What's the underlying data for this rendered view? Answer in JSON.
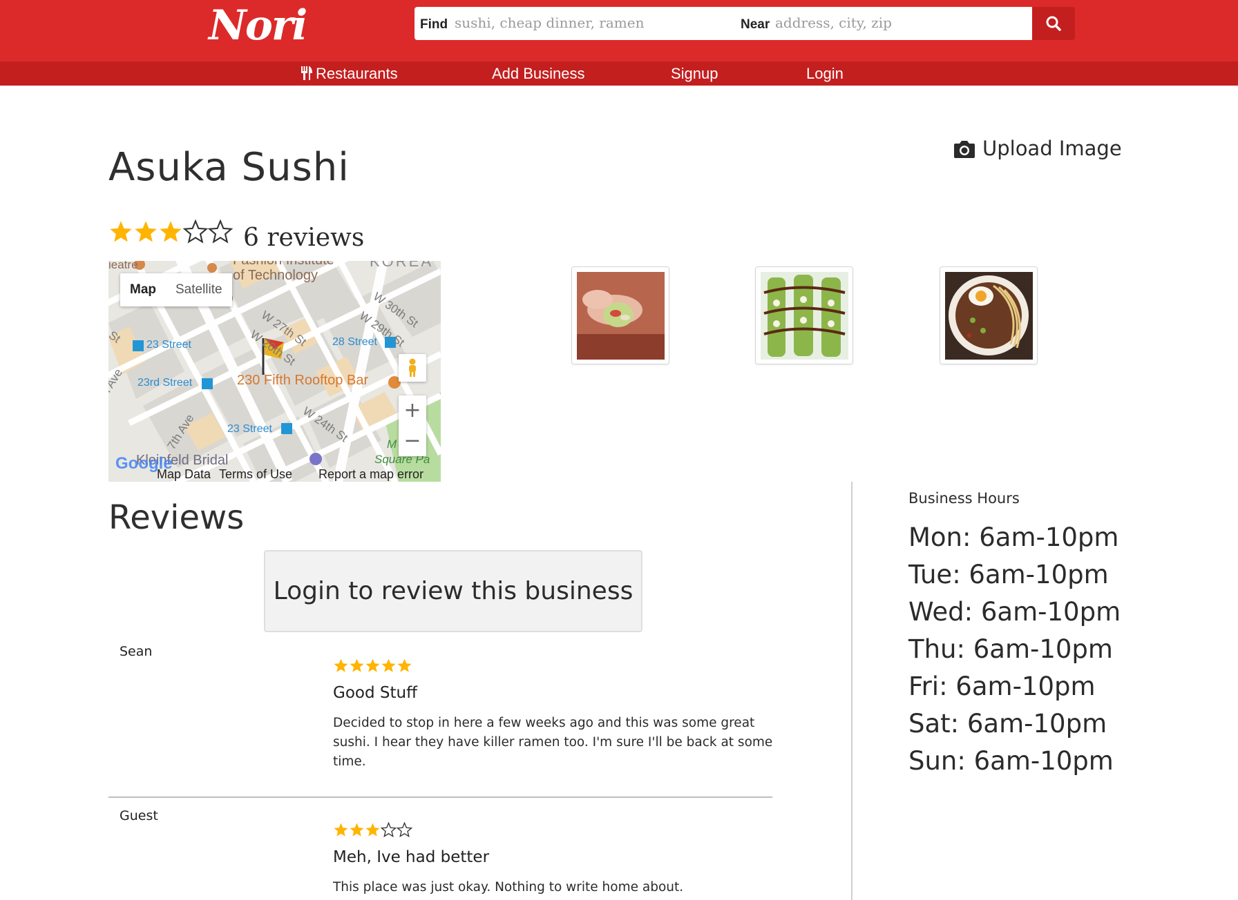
{
  "header": {
    "logo": "Nori",
    "find_label": "Find",
    "find_placeholder": "sushi, cheap dinner, ramen",
    "near_label": "Near",
    "near_placeholder": "address, city, zip",
    "search_icon": "search-icon"
  },
  "nav": {
    "items": [
      {
        "label": "Restaurants",
        "icon": "utensils-icon"
      },
      {
        "label": "Add Business"
      },
      {
        "label": "Signup"
      },
      {
        "label": "Login"
      }
    ]
  },
  "business": {
    "name": "Asuka Sushi",
    "upload_label": "Upload Image",
    "rating": 3,
    "rating_max": 5,
    "review_count": "6 reviews"
  },
  "map": {
    "type_map": "Map",
    "type_satellite": "Satellite",
    "zoom_in": "+",
    "zoom_out": "−",
    "labels": {
      "theatre": "ieatre",
      "fashion_1": "Fashion Institute",
      "fashion_2": "of Technology",
      "korea": "KOREA",
      "w30": "W 30th St",
      "w29": "W 29th St",
      "w27": "W 27th St",
      "w26": "W 26th St",
      "street23_m": "23 Street",
      "street28": "28 Street",
      "street23rd": "23rd Street",
      "rooftop": "230 Fifth Rooftop Bar",
      "w24": "W 24th St",
      "street23_b": "23 Street",
      "ave7": "7th Ave",
      "ave_left": "h Ave",
      "st_left": "St",
      "kleinfeld": "Kleinfeld Bridal",
      "madison_1": "M     on",
      "madison_2": "Square Pa",
      "google": "Google"
    },
    "footer": {
      "map_data": "Map Data",
      "terms": "Terms of Use",
      "report": "Report a map error"
    }
  },
  "photos": [
    {
      "alt": "sushi hand roll"
    },
    {
      "alt": "avocado sushi rolls"
    },
    {
      "alt": "ramen bowl with egg"
    }
  ],
  "reviews_section": {
    "title": "Reviews",
    "login_prompt": "Login to review this business",
    "items": [
      {
        "author": "Sean",
        "rating": 5,
        "title": "Good Stuff",
        "body": "Decided to stop in here a few weeks ago and this was some great sushi. I hear they have killer ramen too. I'm sure I'll be back at some time."
      },
      {
        "author": "Guest",
        "rating": 3,
        "title": "Meh, Ive had better",
        "body": "This place was just okay. Nothing to write home about."
      }
    ]
  },
  "hours": {
    "title": "Business Hours",
    "days": [
      "Mon: 6am-10pm",
      "Tue: 6am-10pm",
      "Wed: 6am-10pm",
      "Thu: 6am-10pm",
      "Fri: 6am-10pm",
      "Sat: 6am-10pm",
      "Sun: 6am-10pm"
    ]
  },
  "colors": {
    "brand_red": "#dc2a2a",
    "nav_red": "#c31f1f",
    "star_gold": "#ffb400"
  }
}
